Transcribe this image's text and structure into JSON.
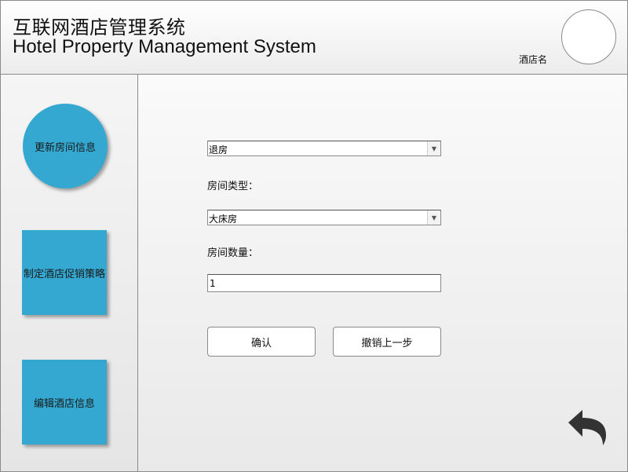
{
  "header": {
    "title_cn": "互联网酒店管理系统",
    "title_en": "Hotel Property Management System",
    "hotel_name": "酒店名"
  },
  "sidebar": {
    "items": [
      {
        "label": "更新房间信息"
      },
      {
        "label": "制定酒店促销策略"
      },
      {
        "label": "编辑酒店信息"
      }
    ]
  },
  "form": {
    "action_select": {
      "value": "退房"
    },
    "room_type_label": "房间类型：",
    "room_type_select": {
      "value": "大床房"
    },
    "room_count_label": "房间数量：",
    "room_count_input": {
      "value": "1"
    },
    "confirm_label": "确认",
    "undo_label": "撤销上一步"
  },
  "icons": {
    "back": "back-arrow-icon",
    "dropdown": "chevron-down-icon",
    "avatar": "avatar-circle"
  }
}
